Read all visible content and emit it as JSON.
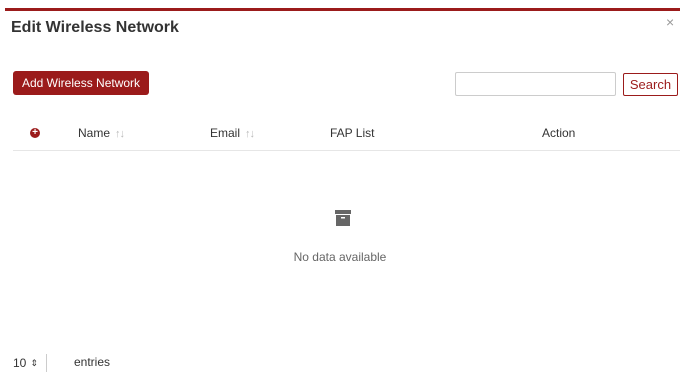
{
  "dialog": {
    "title": "Edit Wireless Network",
    "close_glyph": "×"
  },
  "toolbar": {
    "add_label": "Add Wireless Network",
    "search_value": "",
    "search_label": "Search"
  },
  "table": {
    "expand_icon": "plus-circle-icon",
    "columns": [
      {
        "label": "Name",
        "sortable": true
      },
      {
        "label": "Email",
        "sortable": true
      },
      {
        "label": "FAP List",
        "sortable": false
      },
      {
        "label": "Action",
        "sortable": false
      }
    ],
    "sort_glyph": "↑↓",
    "empty_text": "No data available"
  },
  "footer": {
    "page_length": "10",
    "page_length_arrow": "⇕",
    "entries_label": "entries"
  },
  "colors": {
    "accent": "#9b1b1b"
  }
}
